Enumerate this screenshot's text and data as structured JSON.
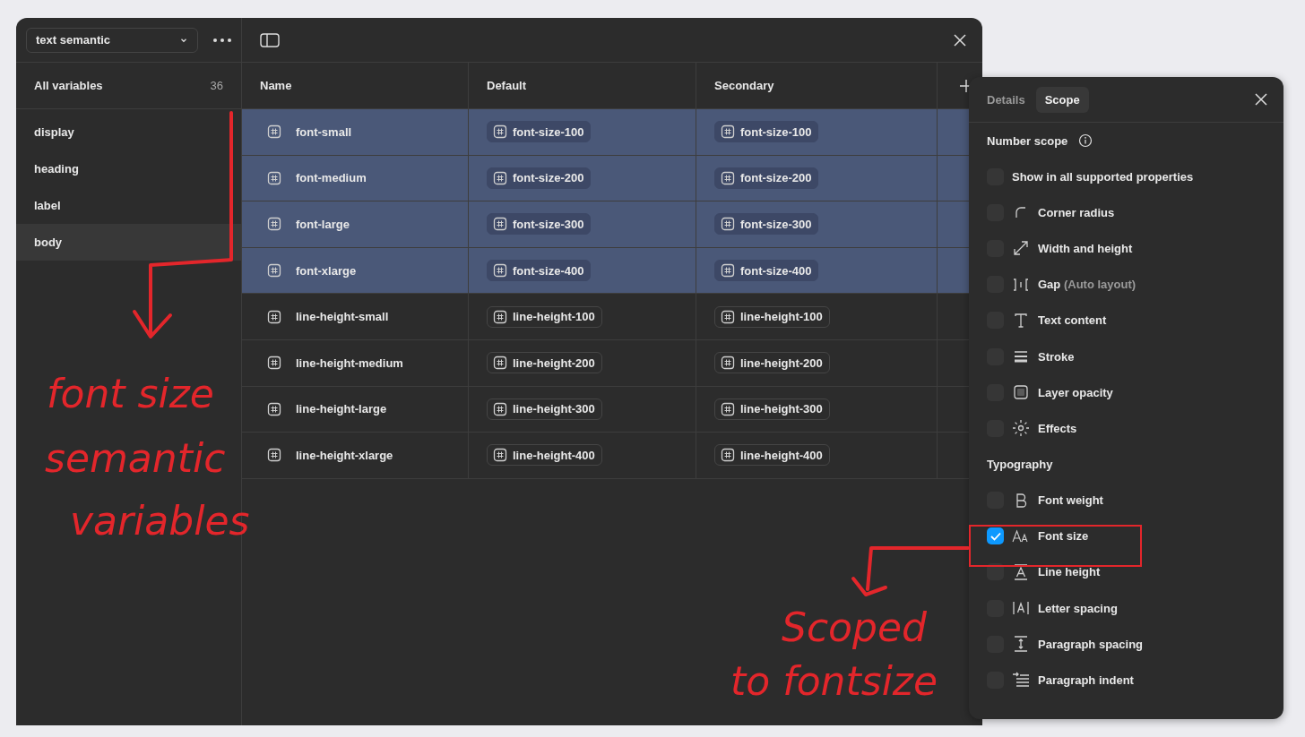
{
  "sidebar": {
    "collection": "text semantic",
    "all_label": "All variables",
    "count": "36",
    "groups": [
      {
        "label": "display",
        "selected": false
      },
      {
        "label": "heading",
        "selected": false
      },
      {
        "label": "label",
        "selected": false
      },
      {
        "label": "body",
        "selected": true
      }
    ]
  },
  "table": {
    "columns": [
      "Name",
      "Default",
      "Secondary"
    ],
    "rows": [
      {
        "name": "font-small",
        "default": "font-size-100",
        "secondary": "font-size-100",
        "selected": true
      },
      {
        "name": "font-medium",
        "default": "font-size-200",
        "secondary": "font-size-200",
        "selected": true
      },
      {
        "name": "font-large",
        "default": "font-size-300",
        "secondary": "font-size-300",
        "selected": true
      },
      {
        "name": "font-xlarge",
        "default": "font-size-400",
        "secondary": "font-size-400",
        "selected": true
      },
      {
        "name": "line-height-small",
        "default": "line-height-100",
        "secondary": "line-height-100",
        "selected": false
      },
      {
        "name": "line-height-medium",
        "default": "line-height-200",
        "secondary": "line-height-200",
        "selected": false
      },
      {
        "name": "line-height-large",
        "default": "line-height-300",
        "secondary": "line-height-300",
        "selected": false
      },
      {
        "name": "line-height-xlarge",
        "default": "line-height-400",
        "secondary": "line-height-400",
        "selected": false
      }
    ]
  },
  "scope_panel": {
    "tabs": [
      {
        "label": "Details",
        "selected": false
      },
      {
        "label": "Scope",
        "selected": true
      }
    ],
    "sections": [
      {
        "title": "Number scope",
        "info": true,
        "items": [
          {
            "label": "Show in all supported properties",
            "checked": false
          },
          {
            "label": "Corner radius",
            "checked": false
          },
          {
            "label": "Width and height",
            "checked": false
          },
          {
            "label": "Gap",
            "note": "(Auto layout)",
            "checked": false
          },
          {
            "label": "Text content",
            "checked": false
          },
          {
            "label": "Stroke",
            "checked": false
          },
          {
            "label": "Layer opacity",
            "checked": false
          },
          {
            "label": "Effects",
            "checked": false
          }
        ]
      },
      {
        "title": "Typography",
        "info": false,
        "items": [
          {
            "label": "Font weight",
            "checked": false
          },
          {
            "label": "Font size",
            "checked": true
          },
          {
            "label": "Line height",
            "checked": false
          },
          {
            "label": "Letter spacing",
            "checked": false
          },
          {
            "label": "Paragraph spacing",
            "checked": false
          },
          {
            "label": "Paragraph indent",
            "checked": false
          }
        ]
      }
    ]
  },
  "annotations": [
    {
      "lines": [
        "font size",
        "semantic",
        "variables"
      ]
    },
    {
      "lines": [
        "Scoped",
        "to fontsize"
      ]
    }
  ]
}
